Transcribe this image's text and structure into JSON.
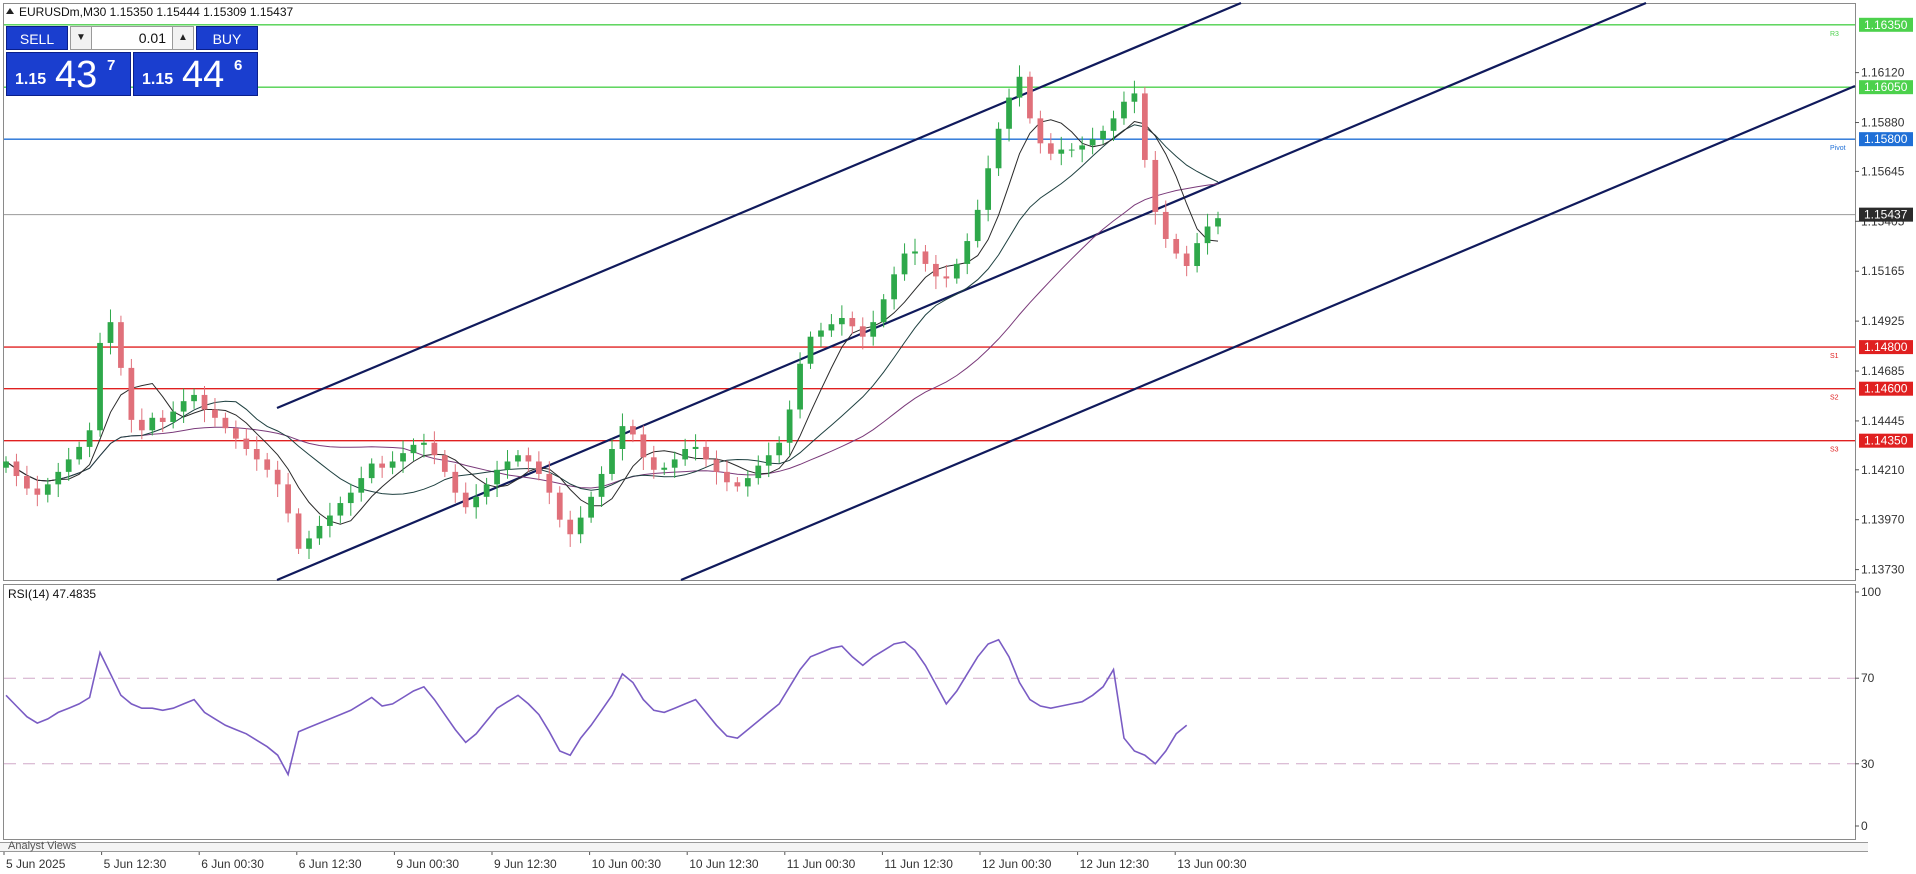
{
  "window": {
    "header": "EURUSDm,M30  1.15350 1.15444 1.15309 1.15437",
    "symbol": "EURUSDm,M30",
    "ohlc": "1.15350 1.15444 1.15309 1.15437"
  },
  "trade_panel": {
    "sell_label": "SELL",
    "buy_label": "BUY",
    "lot_value": "0.01",
    "lot_down_icon": "triangle-down-icon",
    "lot_up_icon": "triangle-up-icon",
    "sell_price": {
      "small": "1.15",
      "big": "43",
      "sup": "7"
    },
    "buy_price": {
      "small": "1.15",
      "big": "44",
      "sup": "6"
    }
  },
  "price_axis": {
    "ticks": [
      "1.16120",
      "1.15880",
      "1.15645",
      "1.15405",
      "1.15165",
      "1.14925",
      "1.14685",
      "1.14445",
      "1.14210",
      "1.13970",
      "1.13730"
    ],
    "tick_values": [
      1.1612,
      1.1588,
      1.15645,
      1.15405,
      1.15165,
      1.14925,
      1.14685,
      1.14445,
      1.1421,
      1.1397,
      1.1373
    ]
  },
  "levels": [
    {
      "price": "1.16350",
      "value": 1.1635,
      "tag": "R3",
      "color": "#4cd14c"
    },
    {
      "price": "1.16050",
      "value": 1.1605,
      "tag": "",
      "color": "#4cd14c"
    },
    {
      "price": "1.15800",
      "value": 1.158,
      "tag": "Pivot",
      "color": "#1f6fd6"
    },
    {
      "price": "1.14800",
      "value": 1.148,
      "tag": "S1",
      "color": "#e02020"
    },
    {
      "price": "1.14600",
      "value": 1.146,
      "tag": "S2",
      "color": "#e02020"
    },
    {
      "price": "1.14350",
      "value": 1.1435,
      "tag": "S3",
      "color": "#e02020"
    }
  ],
  "current_price": {
    "label": "1.15437",
    "value": 1.15437,
    "color": "#2b2b2b"
  },
  "rsi": {
    "label": "RSI(14) 47.4835",
    "levels": [
      "100",
      "70",
      "30",
      "0"
    ],
    "level_values": [
      100,
      70,
      30,
      0
    ]
  },
  "time_axis": [
    "5 Jun 2025",
    "5 Jun 12:30",
    "6 Jun 00:30",
    "6 Jun 12:30",
    "9 Jun 00:30",
    "9 Jun 12:30",
    "10 Jun 00:30",
    "10 Jun 12:30",
    "11 Jun 00:30",
    "11 Jun 12:30",
    "12 Jun 00:30",
    "12 Jun 12:30",
    "13 Jun 00:30"
  ],
  "bottom_tab": "Analyst Views",
  "colors": {
    "bull": "#2ea84a",
    "bear": "#e0707a",
    "channel": "#101a5c",
    "ma_fast": "#2a2a2a",
    "ma_mid": "#1e4040",
    "ma_slow": "#7a3a7a",
    "rsi_line": "#7a5cc4"
  },
  "chart_data": {
    "type": "candlestick",
    "price_range": [
      1.1368,
      1.1645
    ],
    "rsi_range": [
      0,
      100
    ],
    "closes": [
      1.1425,
      1.1418,
      1.1412,
      1.1409,
      1.1414,
      1.142,
      1.1426,
      1.1432,
      1.144,
      1.1482,
      1.1492,
      1.147,
      1.1445,
      1.144,
      1.1446,
      1.1444,
      1.1449,
      1.1454,
      1.1457,
      1.145,
      1.1446,
      1.1441,
      1.1436,
      1.1431,
      1.1426,
      1.1421,
      1.1414,
      1.14,
      1.1383,
      1.1388,
      1.1394,
      1.1399,
      1.1405,
      1.141,
      1.1417,
      1.1424,
      1.1422,
      1.1425,
      1.1429,
      1.1433,
      1.1434,
      1.1428,
      1.142,
      1.141,
      1.1403,
      1.1408,
      1.1414,
      1.1421,
      1.1425,
      1.1428,
      1.1425,
      1.1419,
      1.141,
      1.1397,
      1.139,
      1.1398,
      1.1408,
      1.1419,
      1.1431,
      1.1442,
      1.1438,
      1.1427,
      1.1421,
      1.1422,
      1.1426,
      1.1431,
      1.1432,
      1.1426,
      1.142,
      1.1415,
      1.1413,
      1.1417,
      1.1423,
      1.1428,
      1.1434,
      1.145,
      1.1472,
      1.1485,
      1.1488,
      1.1491,
      1.1494,
      1.149,
      1.1485,
      1.1492,
      1.1503,
      1.1515,
      1.1525,
      1.1526,
      1.152,
      1.1514,
      1.1513,
      1.152,
      1.1531,
      1.1546,
      1.1566,
      1.1585,
      1.16,
      1.161,
      1.159,
      1.1578,
      1.1573,
      1.1575,
      1.1575,
      1.1577,
      1.158,
      1.1584,
      1.159,
      1.1598,
      1.1602,
      1.157,
      1.1545,
      1.1532,
      1.1525,
      1.1519,
      1.153,
      1.1538,
      1.1542
    ],
    "rsi": [
      62,
      57,
      52,
      49,
      51,
      54,
      56,
      58,
      61,
      82,
      72,
      62,
      58,
      56,
      56,
      55,
      56,
      58,
      60,
      54,
      51,
      48,
      46,
      44,
      41,
      38,
      34,
      25,
      45,
      47,
      49,
      51,
      53,
      55,
      58,
      61,
      57,
      58,
      61,
      64,
      66,
      60,
      53,
      46,
      40,
      44,
      50,
      56,
      59,
      62,
      58,
      53,
      45,
      36,
      34,
      42,
      48,
      55,
      62,
      72,
      68,
      60,
      55,
      54,
      56,
      58,
      60,
      54,
      48,
      43,
      42,
      46,
      50,
      54,
      58,
      66,
      74,
      80,
      82,
      84,
      85,
      80,
      76,
      80,
      83,
      86,
      87,
      83,
      76,
      67,
      58,
      64,
      72,
      80,
      86,
      88,
      80,
      68,
      60,
      57,
      56,
      57,
      58,
      59,
      62,
      66,
      74,
      42,
      36,
      34,
      30,
      36,
      44,
      48
    ]
  }
}
